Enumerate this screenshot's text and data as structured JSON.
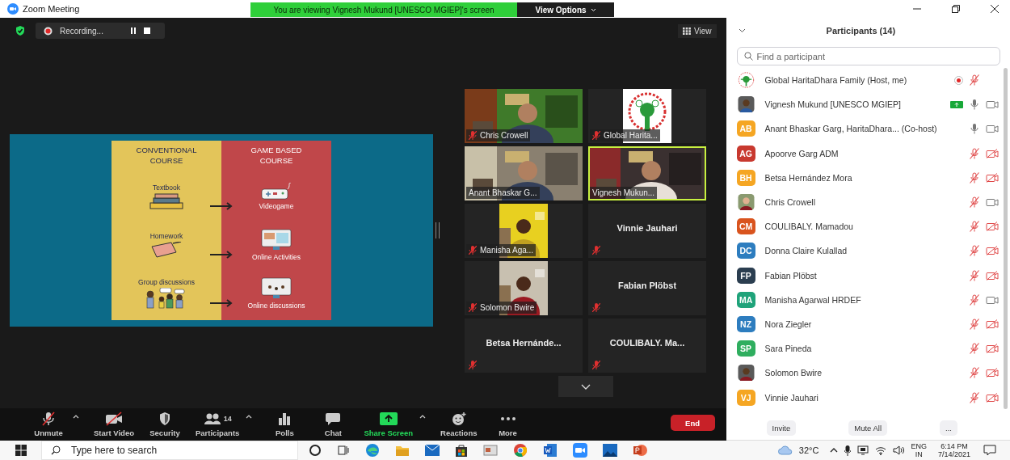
{
  "window": {
    "title": "Zoom Meeting",
    "banner": "You are viewing Vignesh Mukund [UNESCO MGIEP]'s screen",
    "view_options": "View Options"
  },
  "recording": {
    "label": "Recording..."
  },
  "view_button": {
    "label": "View"
  },
  "slide": {
    "headings": [
      "CONVENTIONAL COURSE",
      "GAME BASED COURSE"
    ],
    "rows": [
      {
        "from": "Textbook",
        "to": "Videogame",
        "kind": "game"
      },
      {
        "from": "Homework",
        "to": "Online Activities",
        "kind": "activities"
      },
      {
        "from": "Group discussions",
        "to": "Online discussions",
        "kind": "discussion"
      }
    ]
  },
  "tiles": [
    {
      "name": "Chris Crowell",
      "kind": "video",
      "muted": true,
      "speaking": false
    },
    {
      "name": "Global Harita...",
      "kind": "logo",
      "muted": true,
      "speaking": false
    },
    {
      "name": "Anant Bhaskar G...",
      "kind": "video",
      "muted": false,
      "speaking": false
    },
    {
      "name": "Vignesh Mukun...",
      "kind": "video",
      "muted": false,
      "speaking": true
    },
    {
      "name": "Manisha Aga...",
      "kind": "portrait",
      "muted": true,
      "speaking": false
    },
    {
      "name": "Vinnie Jauhari",
      "kind": "name",
      "muted": true,
      "speaking": false
    },
    {
      "name": "Solomon Bwire",
      "kind": "portrait",
      "muted": true,
      "speaking": false
    },
    {
      "name": "Fabian Plöbst",
      "kind": "name",
      "muted": true,
      "speaking": false
    },
    {
      "name": "Betsa  Hernánde...",
      "kind": "name",
      "muted": true,
      "speaking": false
    },
    {
      "name": "COULIBALY.  Ma...",
      "kind": "name",
      "muted": true,
      "speaking": false
    }
  ],
  "toolbar": [
    {
      "label": "Unmute",
      "kind": "mic",
      "caret": true
    },
    {
      "label": "Start Video",
      "kind": "video",
      "caret": false
    },
    {
      "label": "Security",
      "kind": "security",
      "caret": false
    },
    {
      "label": "Participants",
      "kind": "participants",
      "caret": true,
      "count": "14"
    },
    {
      "label": "Polls",
      "kind": "polls",
      "caret": false
    },
    {
      "label": "Chat",
      "kind": "chat",
      "caret": false
    },
    {
      "label": "Share Screen",
      "kind": "share",
      "caret": true
    },
    {
      "label": "Reactions",
      "kind": "reactions",
      "caret": false
    },
    {
      "label": "More",
      "kind": "more",
      "caret": false
    }
  ],
  "end_button": "End",
  "participants": {
    "title": "Participants (14)",
    "search": {
      "placeholder": "Find a participant"
    },
    "list": [
      {
        "name": "Global HaritaDhara Family (Host, me)",
        "kind": "logo",
        "recording": true,
        "sharing": false,
        "muted": true
      },
      {
        "name": "Vignesh Mukund [UNESCO MGIEP]",
        "recording": false,
        "sharing": true,
        "muted": false,
        "video_on": true
      },
      {
        "name": "Anant Bhaskar Garg, HaritaDhara... (Co-host)",
        "kind": "initials",
        "initials": "AB",
        "color": "#f5a623",
        "recording": false,
        "sharing": false,
        "muted": false,
        "video_on": true
      },
      {
        "name": "Apoorve Garg ADM",
        "kind": "initials",
        "initials": "AG",
        "color": "#c8392f",
        "recording": false,
        "sharing": false,
        "muted": true,
        "video_on": false
      },
      {
        "name": "Betsa Hernández Mora",
        "kind": "initials",
        "initials": "BH",
        "color": "#f5a623",
        "recording": false,
        "sharing": false,
        "muted": true,
        "video_on": false
      },
      {
        "name": "Chris Crowell",
        "recording": false,
        "sharing": false,
        "muted": true,
        "video_on": true
      },
      {
        "name": "COULIBALY. Mamadou",
        "kind": "initials",
        "initials": "CM",
        "color": "#d9541e",
        "recording": false,
        "sharing": false,
        "muted": true,
        "video_on": false
      },
      {
        "name": "Donna Claire Kulallad",
        "kind": "initials",
        "initials": "DC",
        "color": "#2d7dbf",
        "recording": false,
        "sharing": false,
        "muted": true,
        "video_on": false
      },
      {
        "name": "Fabian Plöbst",
        "kind": "initials",
        "initials": "FP",
        "color": "#2b3e50",
        "recording": false,
        "sharing": false,
        "muted": true,
        "video_on": false
      },
      {
        "name": "Manisha Agarwal HRDEF",
        "kind": "initials",
        "initials": "MA",
        "color": "#1fa37a",
        "recording": false,
        "sharing": false,
        "muted": true,
        "video_on": true
      },
      {
        "name": "Nora Ziegler",
        "kind": "initials",
        "initials": "NZ",
        "color": "#2d7dbf",
        "recording": false,
        "sharing": false,
        "muted": true,
        "video_on": false
      },
      {
        "name": "Sara Pineda",
        "kind": "initials",
        "initials": "SP",
        "color": "#2fae5f",
        "recording": false,
        "sharing": false,
        "muted": true,
        "video_on": false
      },
      {
        "name": "Solomon Bwire",
        "recording": false,
        "sharing": false,
        "muted": true,
        "video_on": false
      },
      {
        "name": "Vinnie Jauhari",
        "kind": "initials",
        "initials": "VJ",
        "color": "#f5a623",
        "recording": false,
        "sharing": false,
        "muted": true,
        "video_on": false
      }
    ],
    "buttons": [
      "Invite",
      "Mute All",
      "..."
    ]
  },
  "taskbar": {
    "search_placeholder": "Type here to search",
    "temperature": "32°C",
    "language": "ENG",
    "region": "IN",
    "time": "6:14 PM",
    "date": "7/14/2021"
  }
}
